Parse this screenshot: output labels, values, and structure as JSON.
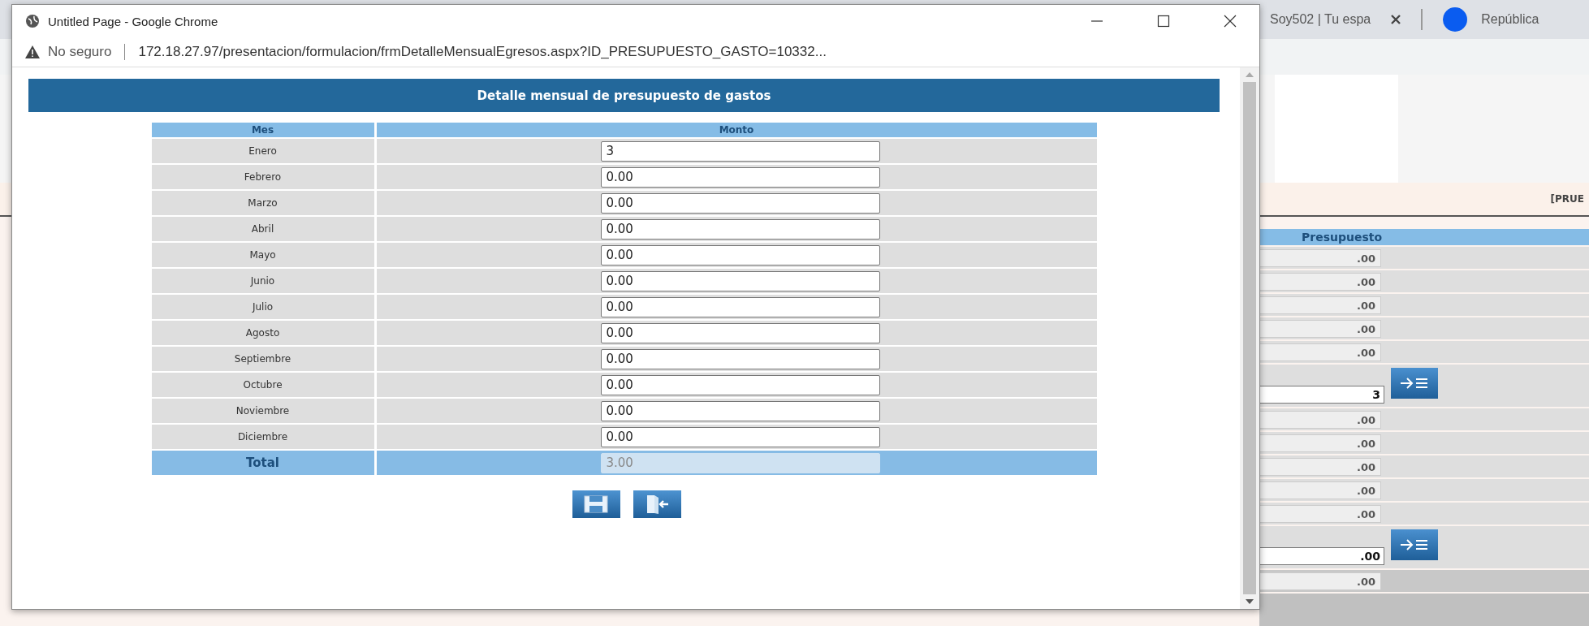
{
  "browser_tabs": [
    {
      "title": "Soy502 | Tu espa"
    },
    {
      "title": "República"
    }
  ],
  "background_page": {
    "banner": "[PRUE",
    "column": "Presupuesto",
    "rows": [
      {
        "kind": "value",
        "amount": ".00"
      },
      {
        "kind": "value",
        "amount": ".00"
      },
      {
        "kind": "value",
        "amount": ".00"
      },
      {
        "kind": "value",
        "amount": ".00"
      },
      {
        "kind": "value",
        "amount": ".00"
      },
      {
        "kind": "input",
        "amount": "3"
      },
      {
        "kind": "value",
        "amount": ".00"
      },
      {
        "kind": "value",
        "amount": ".00"
      },
      {
        "kind": "value",
        "amount": ".00"
      },
      {
        "kind": "value",
        "amount": ".00"
      },
      {
        "kind": "value",
        "amount": ".00"
      },
      {
        "kind": "input",
        "amount": ".00"
      },
      {
        "kind": "summary",
        "amount": ".00"
      }
    ]
  },
  "popup": {
    "title": "Untitled Page - Google Chrome",
    "security": "No seguro",
    "url": "172.18.27.97/presentacion/formulacion/frmDetalleMensualEgresos.aspx?ID_PRESUPUESTO_GASTO=10332...",
    "heading": "Detalle mensual de presupuesto de gastos",
    "columns": [
      "Mes",
      "Monto"
    ],
    "rows": [
      {
        "month": "Enero",
        "amount": "3"
      },
      {
        "month": "Febrero",
        "amount": "0.00"
      },
      {
        "month": "Marzo",
        "amount": "0.00"
      },
      {
        "month": "Abril",
        "amount": "0.00"
      },
      {
        "month": "Mayo",
        "amount": "0.00"
      },
      {
        "month": "Junio",
        "amount": "0.00"
      },
      {
        "month": "Julio",
        "amount": "0.00"
      },
      {
        "month": "Agosto",
        "amount": "0.00"
      },
      {
        "month": "Septiembre",
        "amount": "0.00"
      },
      {
        "month": "Octubre",
        "amount": "0.00"
      },
      {
        "month": "Noviembre",
        "amount": "0.00"
      },
      {
        "month": "Diciembre",
        "amount": "0.00"
      }
    ],
    "total": {
      "label": "Total",
      "amount": "3.00",
      "disabled": true
    }
  }
}
